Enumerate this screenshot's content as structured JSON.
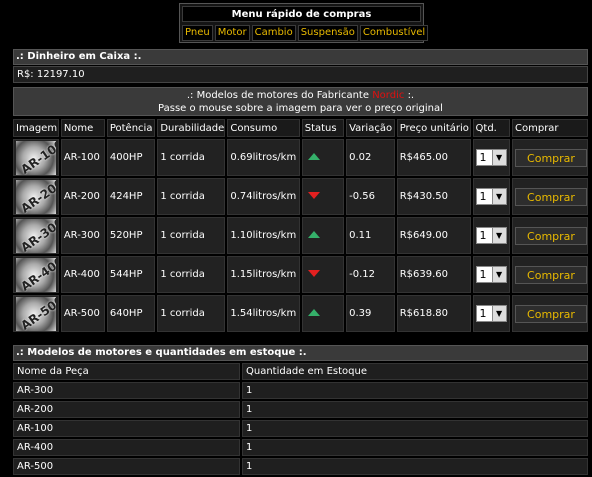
{
  "quick_menu": {
    "title": "Menu rápido de compras",
    "links": [
      "Pneu",
      "Motor",
      "Cambio",
      "Suspensão",
      "Combustível"
    ]
  },
  "cash": {
    "header": ".: Dinheiro em Caixa :.",
    "value": "R$: 12197.10"
  },
  "models": {
    "header_prefix": ".: Modelos de motores do Fabricante",
    "brand": "Nordic",
    "header_suffix": ":.",
    "hint": "Passe o mouse sobre a imagem para ver o preço original",
    "columns": [
      "Imagem",
      "Nome",
      "Potência",
      "Durabilidade",
      "Consumo",
      "Status",
      "Variação",
      "Preço unitário",
      "Qtd.",
      "Comprar"
    ],
    "rows": [
      {
        "thumb": "AR-100",
        "name": "AR-100",
        "power": "400HP",
        "durability": "1 corrida",
        "consumption": "0.69litros/km",
        "status": "up",
        "variation": "0.02",
        "price": "R$465.00",
        "qty": "1",
        "buy": "Comprar"
      },
      {
        "thumb": "AR-200",
        "name": "AR-200",
        "power": "424HP",
        "durability": "1 corrida",
        "consumption": "0.74litros/km",
        "status": "down",
        "variation": "-0.56",
        "price": "R$430.50",
        "qty": "1",
        "buy": "Comprar"
      },
      {
        "thumb": "AR-300",
        "name": "AR-300",
        "power": "520HP",
        "durability": "1 corrida",
        "consumption": "1.10litros/km",
        "status": "up",
        "variation": "0.11",
        "price": "R$649.00",
        "qty": "1",
        "buy": "Comprar"
      },
      {
        "thumb": "AR-400",
        "name": "AR-400",
        "power": "544HP",
        "durability": "1 corrida",
        "consumption": "1.15litros/km",
        "status": "down",
        "variation": "-0.12",
        "price": "R$639.60",
        "qty": "1",
        "buy": "Comprar"
      },
      {
        "thumb": "AR-500",
        "name": "AR-500",
        "power": "640HP",
        "durability": "1 corrida",
        "consumption": "1.54litros/km",
        "status": "up",
        "variation": "0.39",
        "price": "R$618.80",
        "qty": "1",
        "buy": "Comprar"
      }
    ]
  },
  "stock": {
    "header": ".: Modelos de motores e quantidades em estoque :.",
    "columns": [
      "Nome da Peça",
      "Quantidade em Estoque"
    ],
    "rows": [
      {
        "name": "AR-300",
        "qty": "1"
      },
      {
        "name": "AR-200",
        "qty": "1"
      },
      {
        "name": "AR-100",
        "qty": "1"
      },
      {
        "name": "AR-400",
        "qty": "1"
      },
      {
        "name": "AR-500",
        "qty": "1"
      }
    ]
  },
  "colors": {
    "accent": "#e8b900",
    "brand": "#e01010",
    "up": "#35b06a",
    "down": "#e32020"
  }
}
